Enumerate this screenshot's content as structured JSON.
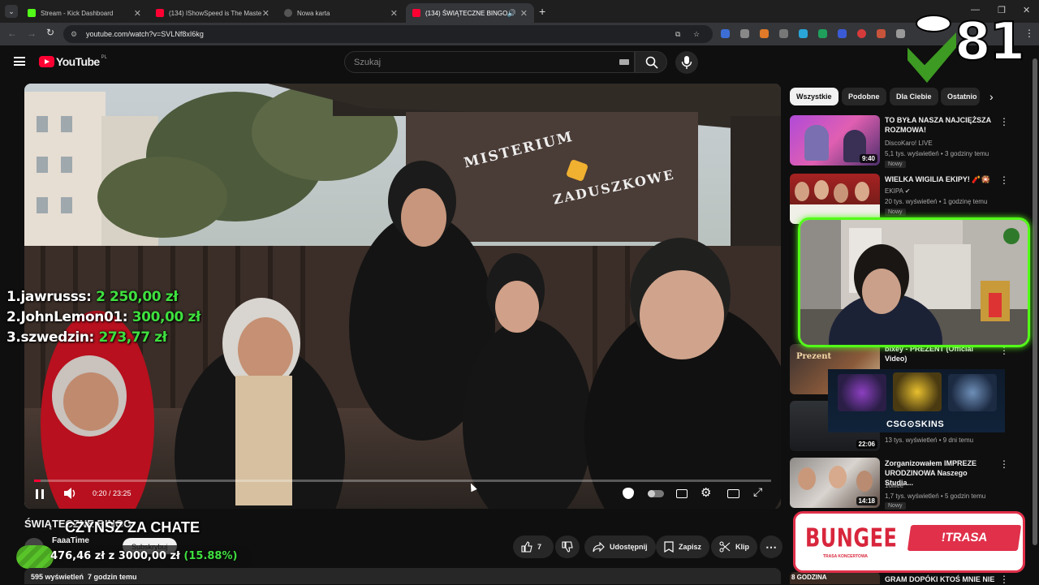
{
  "browser": {
    "tabs": [
      {
        "title": "Stream - Kick Dashboard",
        "color": "#53fc18"
      },
      {
        "title": "(134) IShowSpeed is The Maste",
        "color": "#ff0033"
      },
      {
        "title": "Nowa karta",
        "color": "#8ab4f8"
      },
      {
        "title": "(134) ŚWIĄTECZNE BINGO",
        "color": "#ff0033"
      }
    ],
    "url": "youtube.com/watch?v=SVLNf8xI6kg"
  },
  "youtube": {
    "logo": "YouTube",
    "region": "PL",
    "search_placeholder": "Szukaj"
  },
  "player": {
    "time": "0:20 / 23:25",
    "banner_words": [
      "MISTERIUM",
      "ZADUSZKOWE"
    ]
  },
  "overlay": {
    "donors": [
      {
        "name": "1.jawrusss:",
        "amount": "2 250,00 zł"
      },
      {
        "name": "2.JohnLemon01:",
        "amount": "300,00 zł"
      },
      {
        "name": "3.szwedzin:",
        "amount": "273,77 zł"
      }
    ],
    "goal_title": "CZYNSZ ZA CHATE",
    "goal_current": "476,46 zł",
    "goal_mid": "z",
    "goal_target": "3000,00 zł",
    "goal_pct": "(15.88%)",
    "goal_fraction": 0.1588,
    "counter": "81",
    "bungee": "BUNGEE",
    "bungee_sub": "TRASA KONCERTOWA",
    "trasa": "!TRASA",
    "csg": "CSG⊙SKINS"
  },
  "video_info": {
    "title": "ŚWIĄTECZNE BINGO",
    "channel": "FaaaTime",
    "subscribe": "Subskrybuj",
    "views_line": "595 wyświetleń  7 godzin temu",
    "likes": "7",
    "share": "Udostępnij",
    "save": "Zapisz",
    "clip": "Klip"
  },
  "chips": [
    "Wszystkie",
    "Podobne",
    "Dla Ciebie",
    "Ostatnio"
  ],
  "recs": [
    {
      "title": "TO BYŁA NASZA NAJCIĘŻSZA ROZMOWA!",
      "channel": "DiscoKaro! LIVE",
      "meta": "5,1 tys. wyświetleń • 3 godziny temu",
      "duration": "9:40",
      "badge": "Nowy"
    },
    {
      "title": "WIELKA WIGILIA EKIPY! 🧨🎇",
      "channel": "EKIPA ✔",
      "meta": "20 tys. wyświetleń • 1 godzinę temu",
      "duration": "",
      "badge": "Nowy"
    },
    {
      "title": "bixey - PREZENT (Official Video)",
      "channel": "",
      "meta": "",
      "duration": "",
      "badge": ""
    },
    {
      "title": "",
      "channel": "",
      "meta": "13 tys. wyświetleń • 9 dni temu",
      "duration": "22:06",
      "badge": ""
    },
    {
      "title": "Zorganizowałem IMPREZE URODZINOWA Naszego Studia...",
      "channel": "1olliee",
      "meta": "1,7 tys. wyświetleń • 5 godzin temu",
      "duration": "14:18",
      "badge": "Nowy"
    },
    {
      "title": "GRAM DOPÓKI KTOŚ MNIE NIE",
      "channel": "",
      "meta": "",
      "duration": "8 GODZINA",
      "badge": ""
    }
  ],
  "colors": {
    "kick": "#53fc18",
    "yt_red": "#ff0033",
    "bg": "#0f0f0f"
  }
}
